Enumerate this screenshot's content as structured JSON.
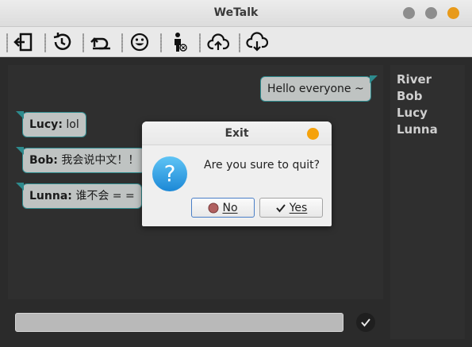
{
  "window": {
    "title": "WeTalk"
  },
  "toolbar": {
    "buttons": [
      {
        "name": "logout-icon"
      },
      {
        "name": "history-icon"
      },
      {
        "name": "undo-icon"
      },
      {
        "name": "emoji-icon"
      },
      {
        "name": "user-remove-icon"
      },
      {
        "name": "upload-cloud-icon"
      },
      {
        "name": "download-cloud-icon"
      }
    ]
  },
  "messages": [
    {
      "side": "right",
      "sender": "",
      "text": "Hello everyone ~"
    },
    {
      "side": "left",
      "sender": "Lucy:",
      "text": " lol"
    },
    {
      "side": "left",
      "sender": "Bob:",
      "text": " 我会说中文！！"
    },
    {
      "side": "left",
      "sender": "Lunna:",
      "text": " 谁不会 = ="
    }
  ],
  "users": [
    "River",
    "Bob",
    "Lucy",
    "Lunna"
  ],
  "input": {
    "value": "",
    "placeholder": ""
  },
  "dialog": {
    "title": "Exit",
    "message": "Are you sure to quit?",
    "no_label": "No",
    "yes_label": "Yes"
  },
  "colors": {
    "accent": "#2e8b8e",
    "bubble": "#bfc3c2",
    "close": "#e89a1a"
  }
}
